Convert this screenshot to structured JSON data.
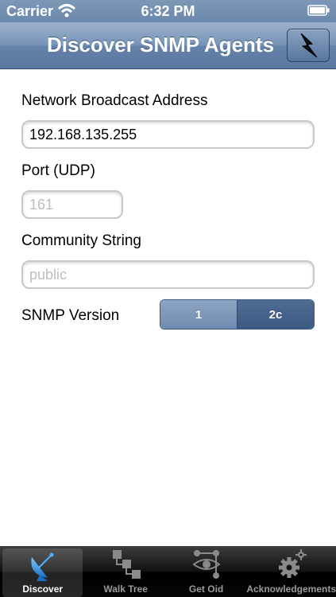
{
  "status_bar": {
    "carrier": "Carrier",
    "time": "6:32 PM"
  },
  "nav": {
    "title": "Discover SNMP Agents",
    "action_icon": "lightning-bolt-icon"
  },
  "form": {
    "broadcast_label": "Network Broadcast Address",
    "broadcast_value": "192.168.135.255",
    "port_label": "Port (UDP)",
    "port_placeholder": "161",
    "community_label": "Community String",
    "community_placeholder": "public",
    "version_label": "SNMP Version",
    "version_options": [
      "1",
      "2c"
    ],
    "version_selected": "2c"
  },
  "tabs": [
    {
      "label": "Discover",
      "icon": "satellite-dish-icon",
      "active": true
    },
    {
      "label": "Walk Tree",
      "icon": "tree-hierarchy-icon",
      "active": false
    },
    {
      "label": "Get Oid",
      "icon": "eye-network-icon",
      "active": false
    },
    {
      "label": "Acknowledgements",
      "icon": "gears-icon",
      "active": false
    }
  ],
  "colors": {
    "nav_bar": "#6b88ab",
    "segment_selected": "#3c5a82",
    "tab_bar": "#000000"
  }
}
